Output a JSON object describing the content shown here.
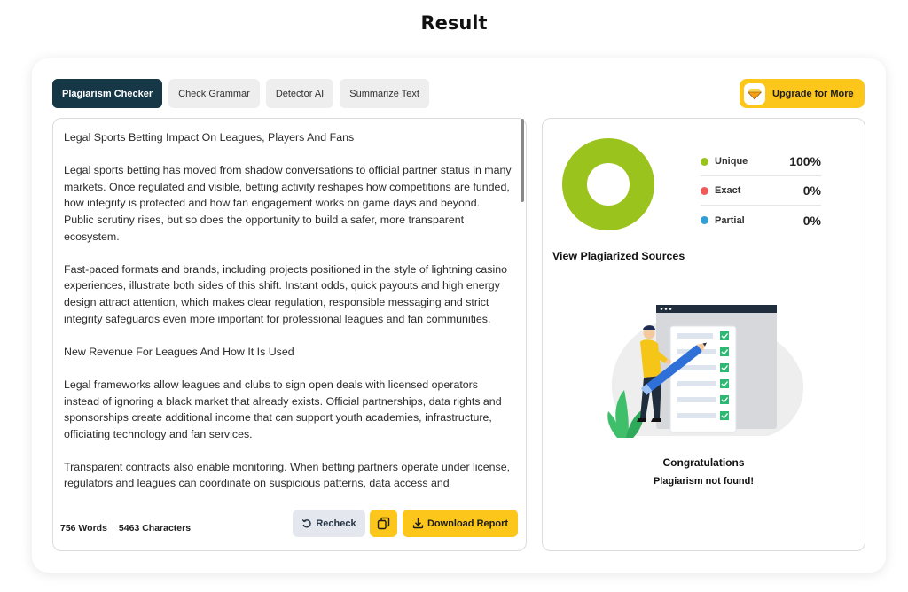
{
  "page": {
    "title": "Result"
  },
  "tabs": [
    {
      "label": "Plagiarism Checker",
      "active": true
    },
    {
      "label": "Check Grammar",
      "active": false
    },
    {
      "label": "Detector AI",
      "active": false
    },
    {
      "label": "Summarize Text",
      "active": false
    }
  ],
  "upgrade": {
    "label": "Upgrade for More",
    "icon": "gem-icon"
  },
  "editor": {
    "paragraphs": [
      "Legal Sports Betting Impact On Leagues, Players And Fans",
      "Legal sports betting has moved from shadow conversations to official partner status in many markets. Once regulated and visible, betting activity reshapes how competitions are funded, how integrity is protected and how fan engagement works on game days and beyond. Public scrutiny rises, but so does the opportunity to build a safer, more transparent ecosystem.",
      "Fast-paced formats and brands, including projects positioned in the style of lightning casino experiences, illustrate both sides of this shift. Instant odds, quick payouts and high energy design attract attention, which makes clear regulation, responsible messaging and strict integrity safeguards even more important for professional leagues and fan communities.",
      "New Revenue For Leagues And How It Is Used",
      "Legal frameworks allow leagues and clubs to sign open deals with licensed operators instead of ignoring a black market that already exists. Official partnerships, data rights and sponsorships create additional income that can support youth academies, infrastructure, officiating technology and fan services.",
      "Transparent contracts also enable monitoring. When betting partners operate under license, regulators and leagues can coordinate on suspicious patterns, data access and"
    ],
    "words": "756 Words",
    "characters": "5463 Characters",
    "recheck_label": "Recheck",
    "download_label": "Download Report"
  },
  "results": {
    "legend": [
      {
        "label": "Unique",
        "value": "100%",
        "color": "#9bc31d",
        "percent": 100
      },
      {
        "label": "Exact",
        "value": "0%",
        "color": "#ef5b5b",
        "percent": 0
      },
      {
        "label": "Partial",
        "value": "0%",
        "color": "#2f9fd3",
        "percent": 0
      }
    ],
    "sources_title": "View Plagiarized Sources",
    "congrats": "Congratulations",
    "status": "Plagiarism not found!"
  },
  "colors": {
    "accent_yellow": "#fcc61a",
    "active_tab": "#163745",
    "unique_green": "#9bc31d"
  }
}
